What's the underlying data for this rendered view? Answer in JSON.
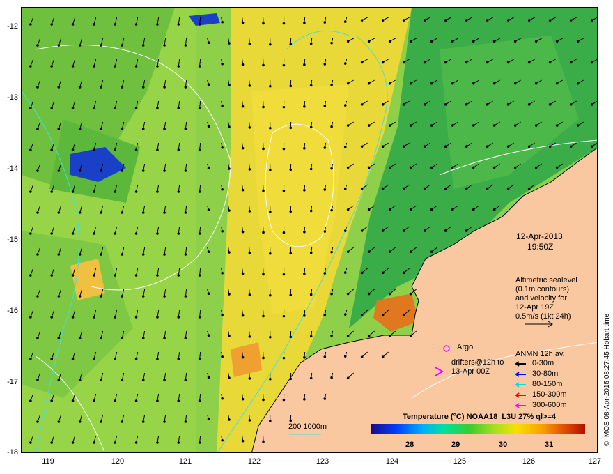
{
  "axes": {
    "y_ticks": [
      "-12",
      "-13",
      "-14",
      "-15",
      "-16",
      "-17",
      "-18"
    ],
    "x_ticks": [
      "119",
      "120",
      "121",
      "122",
      "123",
      "124",
      "125",
      "126",
      "127"
    ]
  },
  "annotation": {
    "date": "12-Apr-2013",
    "time": "19:50Z",
    "altimetry_lines": [
      "Altimetric sealevel",
      "(0.1m contours)",
      "and velocity for",
      "12-Apr 19Z",
      "0.5m/s (1kt 24h)"
    ]
  },
  "argo_label": "Argo",
  "drifters_lines": [
    "drifters@12h to",
    "13-Apr 00Z"
  ],
  "anmn": {
    "title": "ANMN 12h av.",
    "items": [
      {
        "label": "0-30m",
        "color": "#000000"
      },
      {
        "label": "30-80m",
        "color": "#0000ff"
      },
      {
        "label": "80-150m",
        "color": "#00e0e0"
      },
      {
        "label": "150-300m",
        "color": "#ff0000"
      },
      {
        "label": "300-600m",
        "color": "#ff00ff"
      }
    ]
  },
  "contour_key": "200  1000m",
  "colorbar": {
    "title": "Temperature (°C) NOAA18_L3U 27% ql>=4",
    "ticks": [
      "28",
      "29",
      "30",
      "31"
    ]
  },
  "side_note": "© IMOS 08-Apr-2015 08:27:45 Hobart time",
  "colors": {
    "land": "#f9c8a0",
    "sea_main": "#8fd04a",
    "warm_band": "#f0d840",
    "cool_band": "#30b050"
  }
}
